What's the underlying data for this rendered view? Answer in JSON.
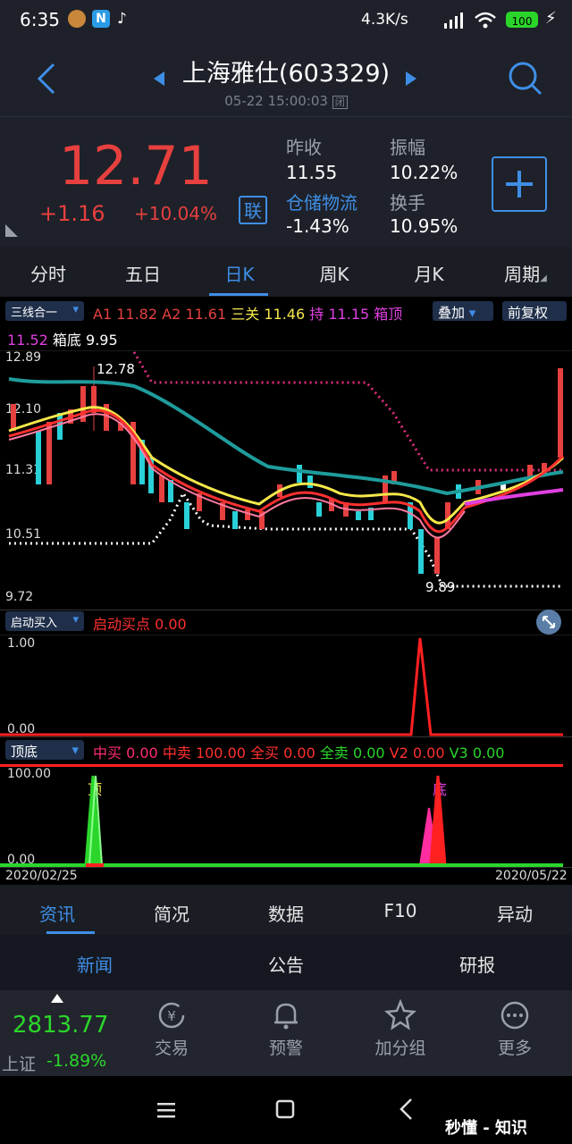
{
  "status": {
    "time": "6:35",
    "speed": "4.3K/s",
    "battery": "100"
  },
  "header": {
    "title": "上海雅仕(603329)",
    "datetime": "05-22 15:00:03",
    "status_badge": "闭"
  },
  "quote": {
    "price": "12.71",
    "change": "+1.16",
    "change_pct": "+10.04%",
    "lian_label": "联",
    "prev_close_label": "昨收",
    "prev_close": "11.55",
    "amplitude_label": "振幅",
    "amplitude": "10.22%",
    "sector_label": "仓储物流",
    "sector_change": "-1.43%",
    "turnover_label": "换手",
    "turnover": "10.95%"
  },
  "tabs": [
    "分时",
    "五日",
    "日K",
    "周K",
    "月K",
    "周期"
  ],
  "chart_header": {
    "indicator_select": "三线合一",
    "a1_label": "A1",
    "a1": "11.82",
    "a2_label": "A2",
    "a2": "11.61",
    "sanguan_label": "三关",
    "sanguan": "11.46",
    "chi_label": "持",
    "chi": "11.15",
    "xiangding_label": "箱顶",
    "xiangding": "11.52",
    "xiangdi_label": "箱底",
    "xiangdi": "9.95",
    "overlay_button": "叠加",
    "adjust_button": "前复权"
  },
  "main_axis": {
    "labels": [
      "12.89",
      "12.10",
      "11.31",
      "10.51",
      "9.72"
    ],
    "high_mark": "12.78",
    "low_mark": "9.89"
  },
  "sub1": {
    "select": "启动买入",
    "title": "启动买点",
    "value": "0.00",
    "axis": [
      "1.00",
      "0.00"
    ]
  },
  "sub2": {
    "select": "顶底",
    "items": [
      {
        "label": "中买",
        "value": "0.00",
        "color": "#ff2d6f"
      },
      {
        "label": "中卖",
        "value": "100.00",
        "color": "#ff3030"
      },
      {
        "label": "全买",
        "value": "0.00",
        "color": "#ff3030"
      },
      {
        "label": "全卖",
        "value": "0.00",
        "color": "#2bd62b"
      },
      {
        "label": "V2",
        "value": "0.00",
        "color": "#ff3030"
      },
      {
        "label": "V3",
        "value": "0.00",
        "color": "#2bd62b"
      }
    ],
    "axis": [
      "100.00",
      "0.00"
    ],
    "top_label": "顶",
    "bottom_label": "底",
    "date_start": "2020/02/25",
    "date_end": "2020/05/22"
  },
  "info_tabs": [
    "资讯",
    "简况",
    "数据",
    "F10",
    "异动"
  ],
  "news_tabs": [
    "新闻",
    "公告",
    "研报"
  ],
  "index": {
    "value": "2813.77",
    "name": "上证",
    "change": "-1.89%"
  },
  "bottom_nav": [
    "交易",
    "预警",
    "加分组",
    "更多"
  ],
  "watermark": "秒懂 - 知识",
  "colors": {
    "up": "#e6403f",
    "down": "#2ad0d8",
    "accent": "#3f8ee6",
    "green": "#2bd62b"
  }
}
